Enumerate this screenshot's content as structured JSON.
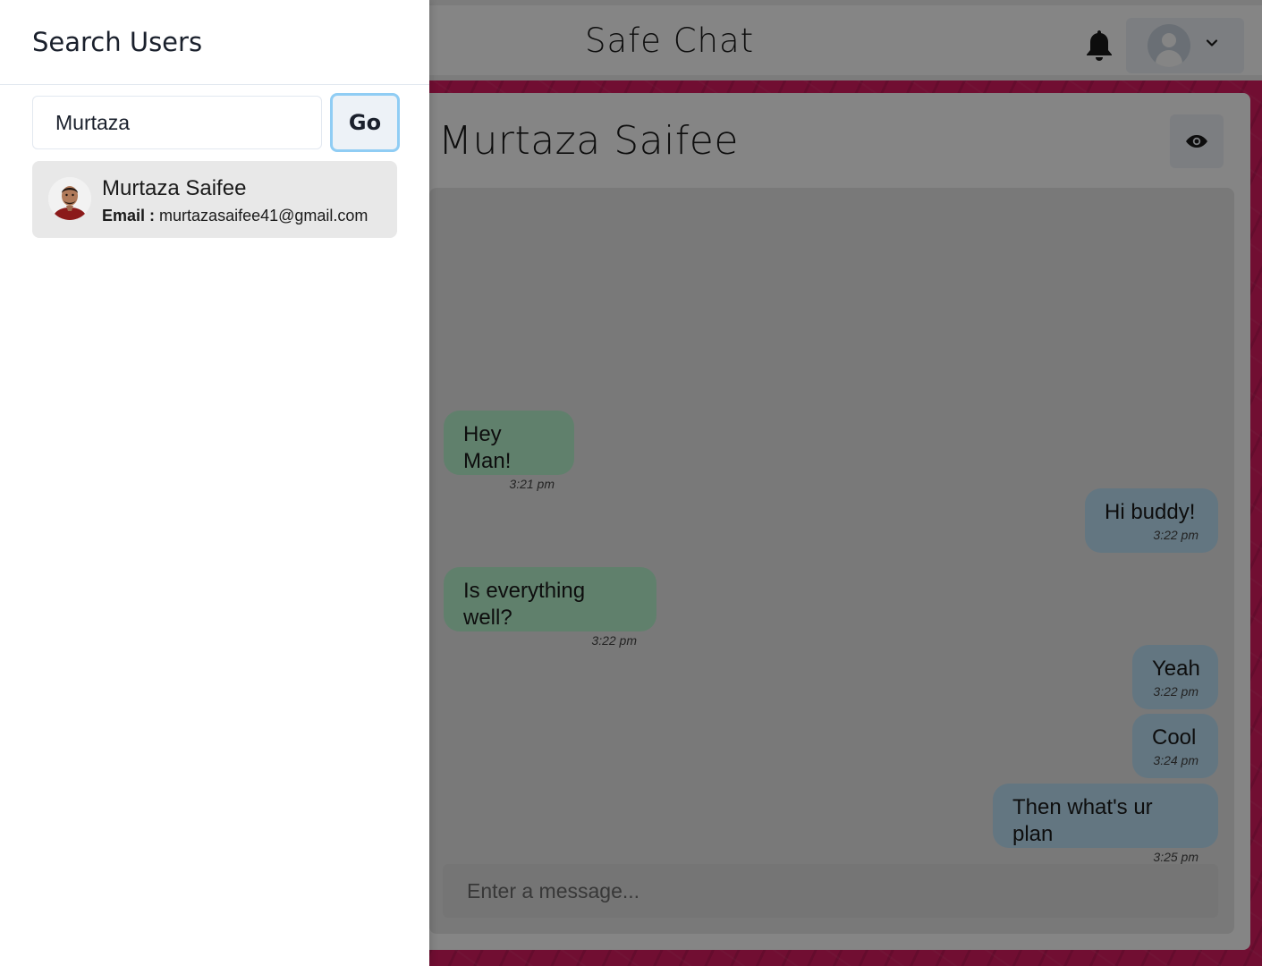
{
  "app": {
    "title": "Safe Chat"
  },
  "chat": {
    "partner_name": "Murtaza Saifee",
    "input_placeholder": "Enter a message...",
    "messages": [
      {
        "text": "Hey Man!",
        "time": "3:21 pm",
        "side": "received"
      },
      {
        "text": "Hi buddy!",
        "time": "3:22 pm",
        "side": "sent"
      },
      {
        "text": "Is everything well?",
        "time": "3:22 pm",
        "side": "received"
      },
      {
        "text": "Yeah",
        "time": "3:22 pm",
        "side": "sent"
      },
      {
        "text": "Cool",
        "time": "3:24 pm",
        "side": "sent"
      },
      {
        "text": "Then what's ur plan",
        "time": "3:25 pm",
        "side": "sent"
      }
    ]
  },
  "drawer": {
    "title": "Search Users",
    "search_value": "Murtaza",
    "go_label": "Go",
    "results": [
      {
        "name": "Murtaza Saifee",
        "email_label": "Email :",
        "email": "murtazasaifee41@gmail.com"
      }
    ]
  },
  "icons": {
    "notification": "bell-icon",
    "profile": "user-avatar-icon",
    "menu": "chevron-down-icon",
    "view_profile": "eye-icon"
  },
  "colors": {
    "received_bubble": "#b9f5d0",
    "sent_bubble": "#bee3f8",
    "background": "#d81b60",
    "focus_ring": "#90cdf4"
  }
}
